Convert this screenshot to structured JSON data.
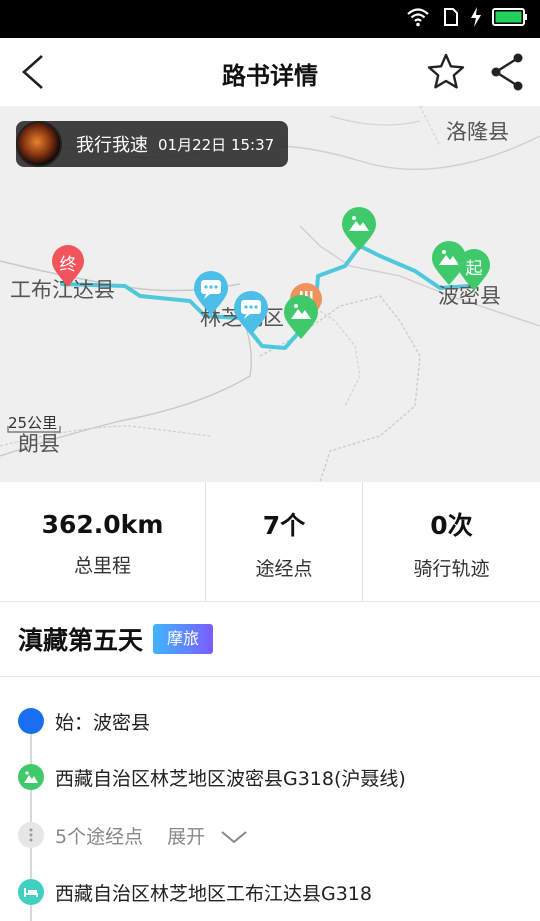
{
  "header": {
    "title": "路书详情"
  },
  "map": {
    "user": {
      "name": "我行我速",
      "time": "01月22日 15:37"
    },
    "labels": {
      "luolong": "洛隆县",
      "gongbu": "工布江达县",
      "linzhi": "林芝地区",
      "bomi": "波密县",
      "lang": "朗县",
      "scale": "25公里"
    },
    "markers": {
      "end": "终",
      "start": "起"
    }
  },
  "stats": {
    "distance": {
      "value": "362.0km",
      "label": "总里程"
    },
    "waypoints": {
      "value": "7个",
      "label": "途经点"
    },
    "tracks": {
      "value": "0次",
      "label": "骑行轨迹"
    }
  },
  "route": {
    "title": "滇藏第五天",
    "badge": "摩旅"
  },
  "points": [
    {
      "text": "始：波密县"
    },
    {
      "text": "西藏自治区林芝地区波密县G318(沪聂线)"
    },
    {
      "text": "5个途经点",
      "action": "展开"
    },
    {
      "text": "西藏自治区林芝地区工布江达县G318"
    }
  ],
  "colors": {
    "route_line": "#4ec8dc",
    "green_marker": "#3fc96b",
    "blue_marker": "#4bbfe8",
    "red_marker": "#f2545b",
    "start_dot": "#1a6ef0"
  }
}
